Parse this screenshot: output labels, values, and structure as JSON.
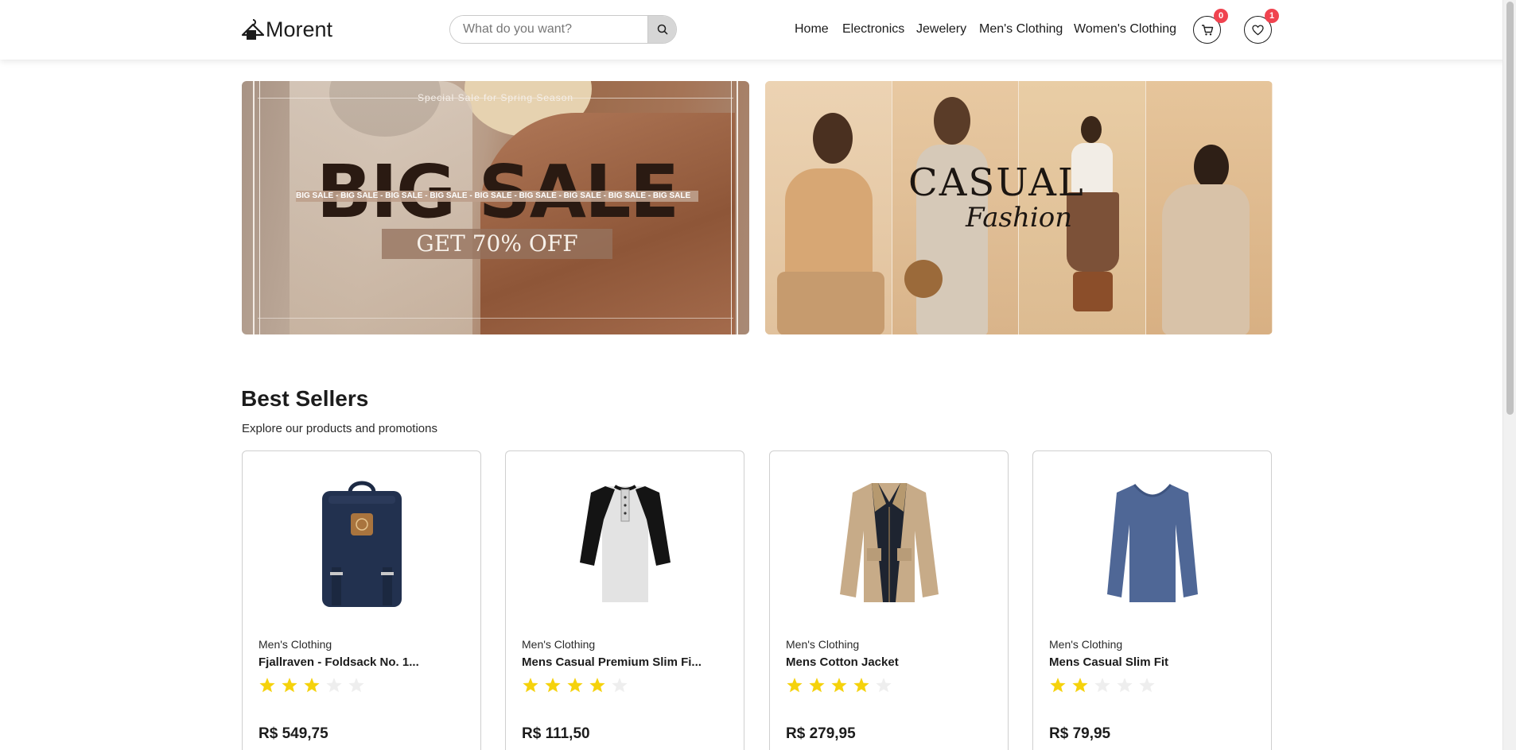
{
  "header": {
    "logo_text": "Morent",
    "search": {
      "placeholder": "What do you want?"
    },
    "nav": [
      "Home",
      "Electronics",
      "Jewelery",
      "Men's Clothing",
      "Women's Clothing"
    ],
    "cart_count": "0",
    "wishlist_count": "1"
  },
  "banners": {
    "left": {
      "tagline": "Special Sale for Spring Season",
      "headline": "BIG SALE",
      "ticker": "BIG SALE - BIG SALE - BIG SALE - BIG SALE - BIG SALE - BIG SALE - BIG SALE - BIG SALE - BIG SALE",
      "offer": "GET 70% OFF"
    },
    "right": {
      "title": "CASUAL",
      "script": "Fashion"
    }
  },
  "best_sellers": {
    "title": "Best Sellers",
    "subtitle": "Explore our products and promotions",
    "products": [
      {
        "category": "Men's Clothing",
        "name": "Fjallraven - Foldsack No. 1...",
        "rating": 3,
        "price": "R$ 549,75",
        "image_icon": "backpack-icon"
      },
      {
        "category": "Men's Clothing",
        "name": "Mens Casual Premium Slim Fi...",
        "rating": 4,
        "price": "R$ 111,50",
        "image_icon": "raglan-shirt-icon"
      },
      {
        "category": "Men's Clothing",
        "name": "Mens Cotton Jacket",
        "rating": 4,
        "price": "R$ 279,95",
        "image_icon": "jacket-icon"
      },
      {
        "category": "Men's Clothing",
        "name": "Mens Casual Slim Fit",
        "rating": 2,
        "price": "R$ 79,95",
        "image_icon": "long-sleeve-shirt-icon"
      }
    ],
    "max_rating": 5
  },
  "colors": {
    "badge": "#f0434f",
    "star_filled": "#f5d20c",
    "star_empty": "#eeeeee"
  }
}
